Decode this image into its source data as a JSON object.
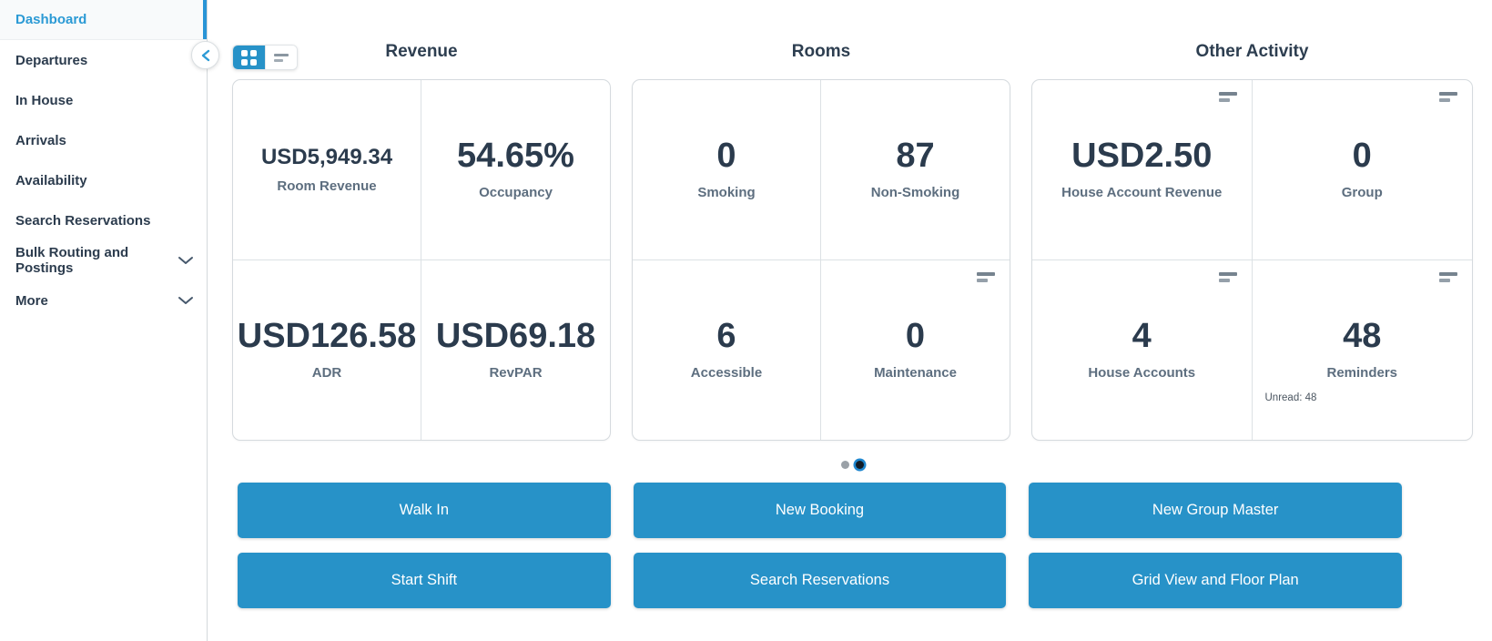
{
  "colors": {
    "primary_button": "#2792c8",
    "active_link": "#2b9ad5",
    "active_indicator": "#2994d6",
    "value_text": "#2b3b4d",
    "label_text": "#5d6e7f"
  },
  "icons": {
    "sidebar_collapse": "chevron-left",
    "sidebar_expand": "chevron-down",
    "view_grid": "grid-2x2-squares",
    "view_list": "two-lines",
    "cell_menu": "two-lines"
  },
  "sidebar": {
    "items": [
      {
        "label": "Dashboard",
        "active": true,
        "expandable": false
      },
      {
        "label": "Departures",
        "active": false,
        "expandable": false
      },
      {
        "label": "In House",
        "active": false,
        "expandable": false
      },
      {
        "label": "Arrivals",
        "active": false,
        "expandable": false
      },
      {
        "label": "Availability",
        "active": false,
        "expandable": false
      },
      {
        "label": "Search Reservations",
        "active": false,
        "expandable": false
      },
      {
        "label": "Bulk Routing and Postings",
        "active": false,
        "expandable": true
      },
      {
        "label": "More",
        "active": false,
        "expandable": true
      }
    ]
  },
  "toolbar": {
    "active_view": "grid"
  },
  "sections": [
    {
      "title": "Revenue",
      "cells": [
        {
          "value": "USD5,949.34",
          "label": "Room Revenue"
        },
        {
          "value": "54.65%",
          "label": "Occupancy"
        },
        {
          "value": "USD126.58",
          "label": "ADR"
        },
        {
          "value": "USD69.18",
          "label": "RevPAR"
        }
      ]
    },
    {
      "title": "Rooms",
      "cells": [
        {
          "value": "0",
          "label": "Smoking"
        },
        {
          "value": "87",
          "label": "Non-Smoking"
        },
        {
          "value": "6",
          "label": "Accessible"
        },
        {
          "value": "0",
          "label": "Maintenance"
        }
      ]
    },
    {
      "title": "Other Activity",
      "cells": [
        {
          "value": "USD2.50",
          "label": "House Account Revenue"
        },
        {
          "value": "0",
          "label": "Group"
        },
        {
          "value": "4",
          "label": "House Accounts"
        },
        {
          "value": "48",
          "label": "Reminders",
          "footnote": "Unread: 48"
        }
      ]
    }
  ],
  "carousel": {
    "page_count": 2,
    "active_page": 2
  },
  "actions": [
    {
      "label": "Walk In"
    },
    {
      "label": "New Booking"
    },
    {
      "label": "New Group Master"
    },
    {
      "label": "Start Shift"
    },
    {
      "label": "Search Reservations"
    },
    {
      "label": "Grid View and Floor Plan"
    }
  ]
}
